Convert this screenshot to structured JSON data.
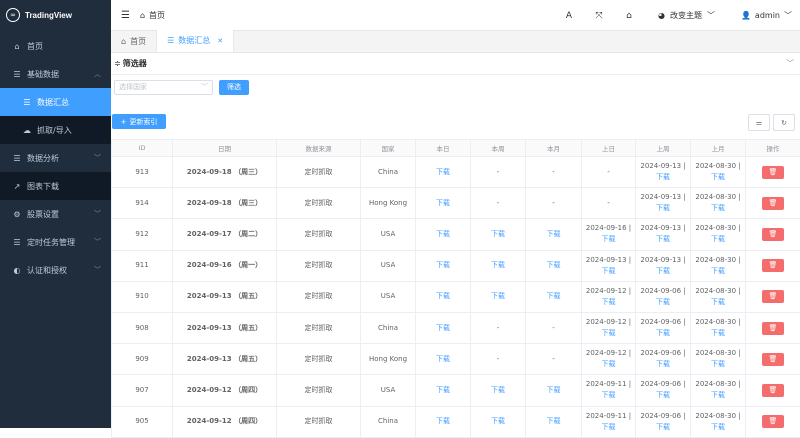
{
  "app": {
    "logo_text": "TradingView"
  },
  "sidebar": {
    "items": [
      {
        "label": "首页",
        "icon": "home-icon"
      },
      {
        "label": "基础数据",
        "icon": "list-icon"
      },
      {
        "label": "数据汇总",
        "icon": "list-icon"
      },
      {
        "label": "抓取/导入",
        "icon": "cloud-download-icon"
      },
      {
        "label": "数据分析",
        "icon": "list-icon"
      },
      {
        "label": "图表下载",
        "icon": "chart-icon"
      },
      {
        "label": "股票设置",
        "icon": "gear-icon"
      },
      {
        "label": "定时任务管理",
        "icon": "list-icon"
      },
      {
        "label": "认证和授权",
        "icon": "shield-icon"
      }
    ]
  },
  "header": {
    "breadcrumb": "首页",
    "theme_label": "改变主题",
    "user_label": "admin"
  },
  "tags": {
    "home": "首页",
    "current": "数据汇总"
  },
  "filter": {
    "title": "筛选器",
    "country_placeholder": "选择国家",
    "filter_button": "筛选"
  },
  "toolbar": {
    "update_button": "更新索引"
  },
  "table": {
    "columns": [
      "ID",
      "日期",
      "数据来源",
      "国家",
      "本日",
      "本周",
      "本月",
      "上日",
      "上周",
      "上月",
      "操作"
    ],
    "rows": [
      {
        "id": "913",
        "date": "2024-09-18 （周三）",
        "source": "定时抓取",
        "country": "China",
        "today": "下载",
        "week": "-",
        "month": "-",
        "prev_day": "-",
        "prev_week_date": "2024-09-13 |",
        "prev_week_link": "下载",
        "prev_month_date": "2024-08-30 |",
        "prev_month_link": "下载"
      },
      {
        "id": "914",
        "date": "2024-09-18 （周三）",
        "source": "定时抓取",
        "country": "Hong Kong",
        "today": "下载",
        "week": "-",
        "month": "-",
        "prev_day": "-",
        "prev_week_date": "2024-09-13 |",
        "prev_week_link": "下载",
        "prev_month_date": "2024-08-30 |",
        "prev_month_link": "下载"
      },
      {
        "id": "912",
        "date": "2024-09-17 （周二）",
        "source": "定时抓取",
        "country": "USA",
        "today": "下载",
        "week": "下载",
        "month": "下载",
        "prev_day_date": "2024-09-16 |",
        "prev_day_link": "下载",
        "prev_week_date": "2024-09-13 |",
        "prev_week_link": "下载",
        "prev_month_date": "2024-08-30 |",
        "prev_month_link": "下载"
      },
      {
        "id": "911",
        "date": "2024-09-16 （周一）",
        "source": "定时抓取",
        "country": "USA",
        "today": "下载",
        "week": "下载",
        "month": "下载",
        "prev_day_date": "2024-09-13 |",
        "prev_day_link": "下载",
        "prev_week_date": "2024-09-13 |",
        "prev_week_link": "下载",
        "prev_month_date": "2024-08-30 |",
        "prev_month_link": "下载"
      },
      {
        "id": "910",
        "date": "2024-09-13 （周五）",
        "source": "定时抓取",
        "country": "USA",
        "today": "下载",
        "week": "下载",
        "month": "下载",
        "prev_day_date": "2024-09-12 |",
        "prev_day_link": "下载",
        "prev_week_date": "2024-09-06 |",
        "prev_week_link": "下载",
        "prev_month_date": "2024-08-30 |",
        "prev_month_link": "下载"
      },
      {
        "id": "908",
        "date": "2024-09-13 （周五）",
        "source": "定时抓取",
        "country": "China",
        "today": "下载",
        "week": "-",
        "month": "-",
        "prev_day_date": "2024-09-12 |",
        "prev_day_link": "下载",
        "prev_week_date": "2024-09-06 |",
        "prev_week_link": "下载",
        "prev_month_date": "2024-08-30 |",
        "prev_month_link": "下载"
      },
      {
        "id": "909",
        "date": "2024-09-13 （周五）",
        "source": "定时抓取",
        "country": "Hong Kong",
        "today": "下载",
        "week": "-",
        "month": "-",
        "prev_day_date": "2024-09-12 |",
        "prev_day_link": "下载",
        "prev_week_date": "2024-09-06 |",
        "prev_week_link": "下载",
        "prev_month_date": "2024-08-30 |",
        "prev_month_link": "下载"
      },
      {
        "id": "907",
        "date": "2024-09-12 （周四）",
        "source": "定时抓取",
        "country": "USA",
        "today": "下载",
        "week": "下载",
        "month": "下载",
        "prev_day_date": "2024-09-11 |",
        "prev_day_link": "下载",
        "prev_week_date": "2024-09-06 |",
        "prev_week_link": "下载",
        "prev_month_date": "2024-08-30 |",
        "prev_month_link": "下载"
      },
      {
        "id": "905",
        "date": "2024-09-12 （周四）",
        "source": "定时抓取",
        "country": "China",
        "today": "下载",
        "week": "下载",
        "month": "下载",
        "prev_day_date": "2024-09-11 |",
        "prev_day_link": "下载",
        "prev_week_date": "2024-09-06 |",
        "prev_week_link": "下载",
        "prev_month_date": "2024-08-30 |",
        "prev_month_link": "下载"
      }
    ]
  },
  "colors": {
    "sidebar_bg": "#1f2d3d",
    "primary": "#409eff",
    "danger": "#f56c6c"
  }
}
